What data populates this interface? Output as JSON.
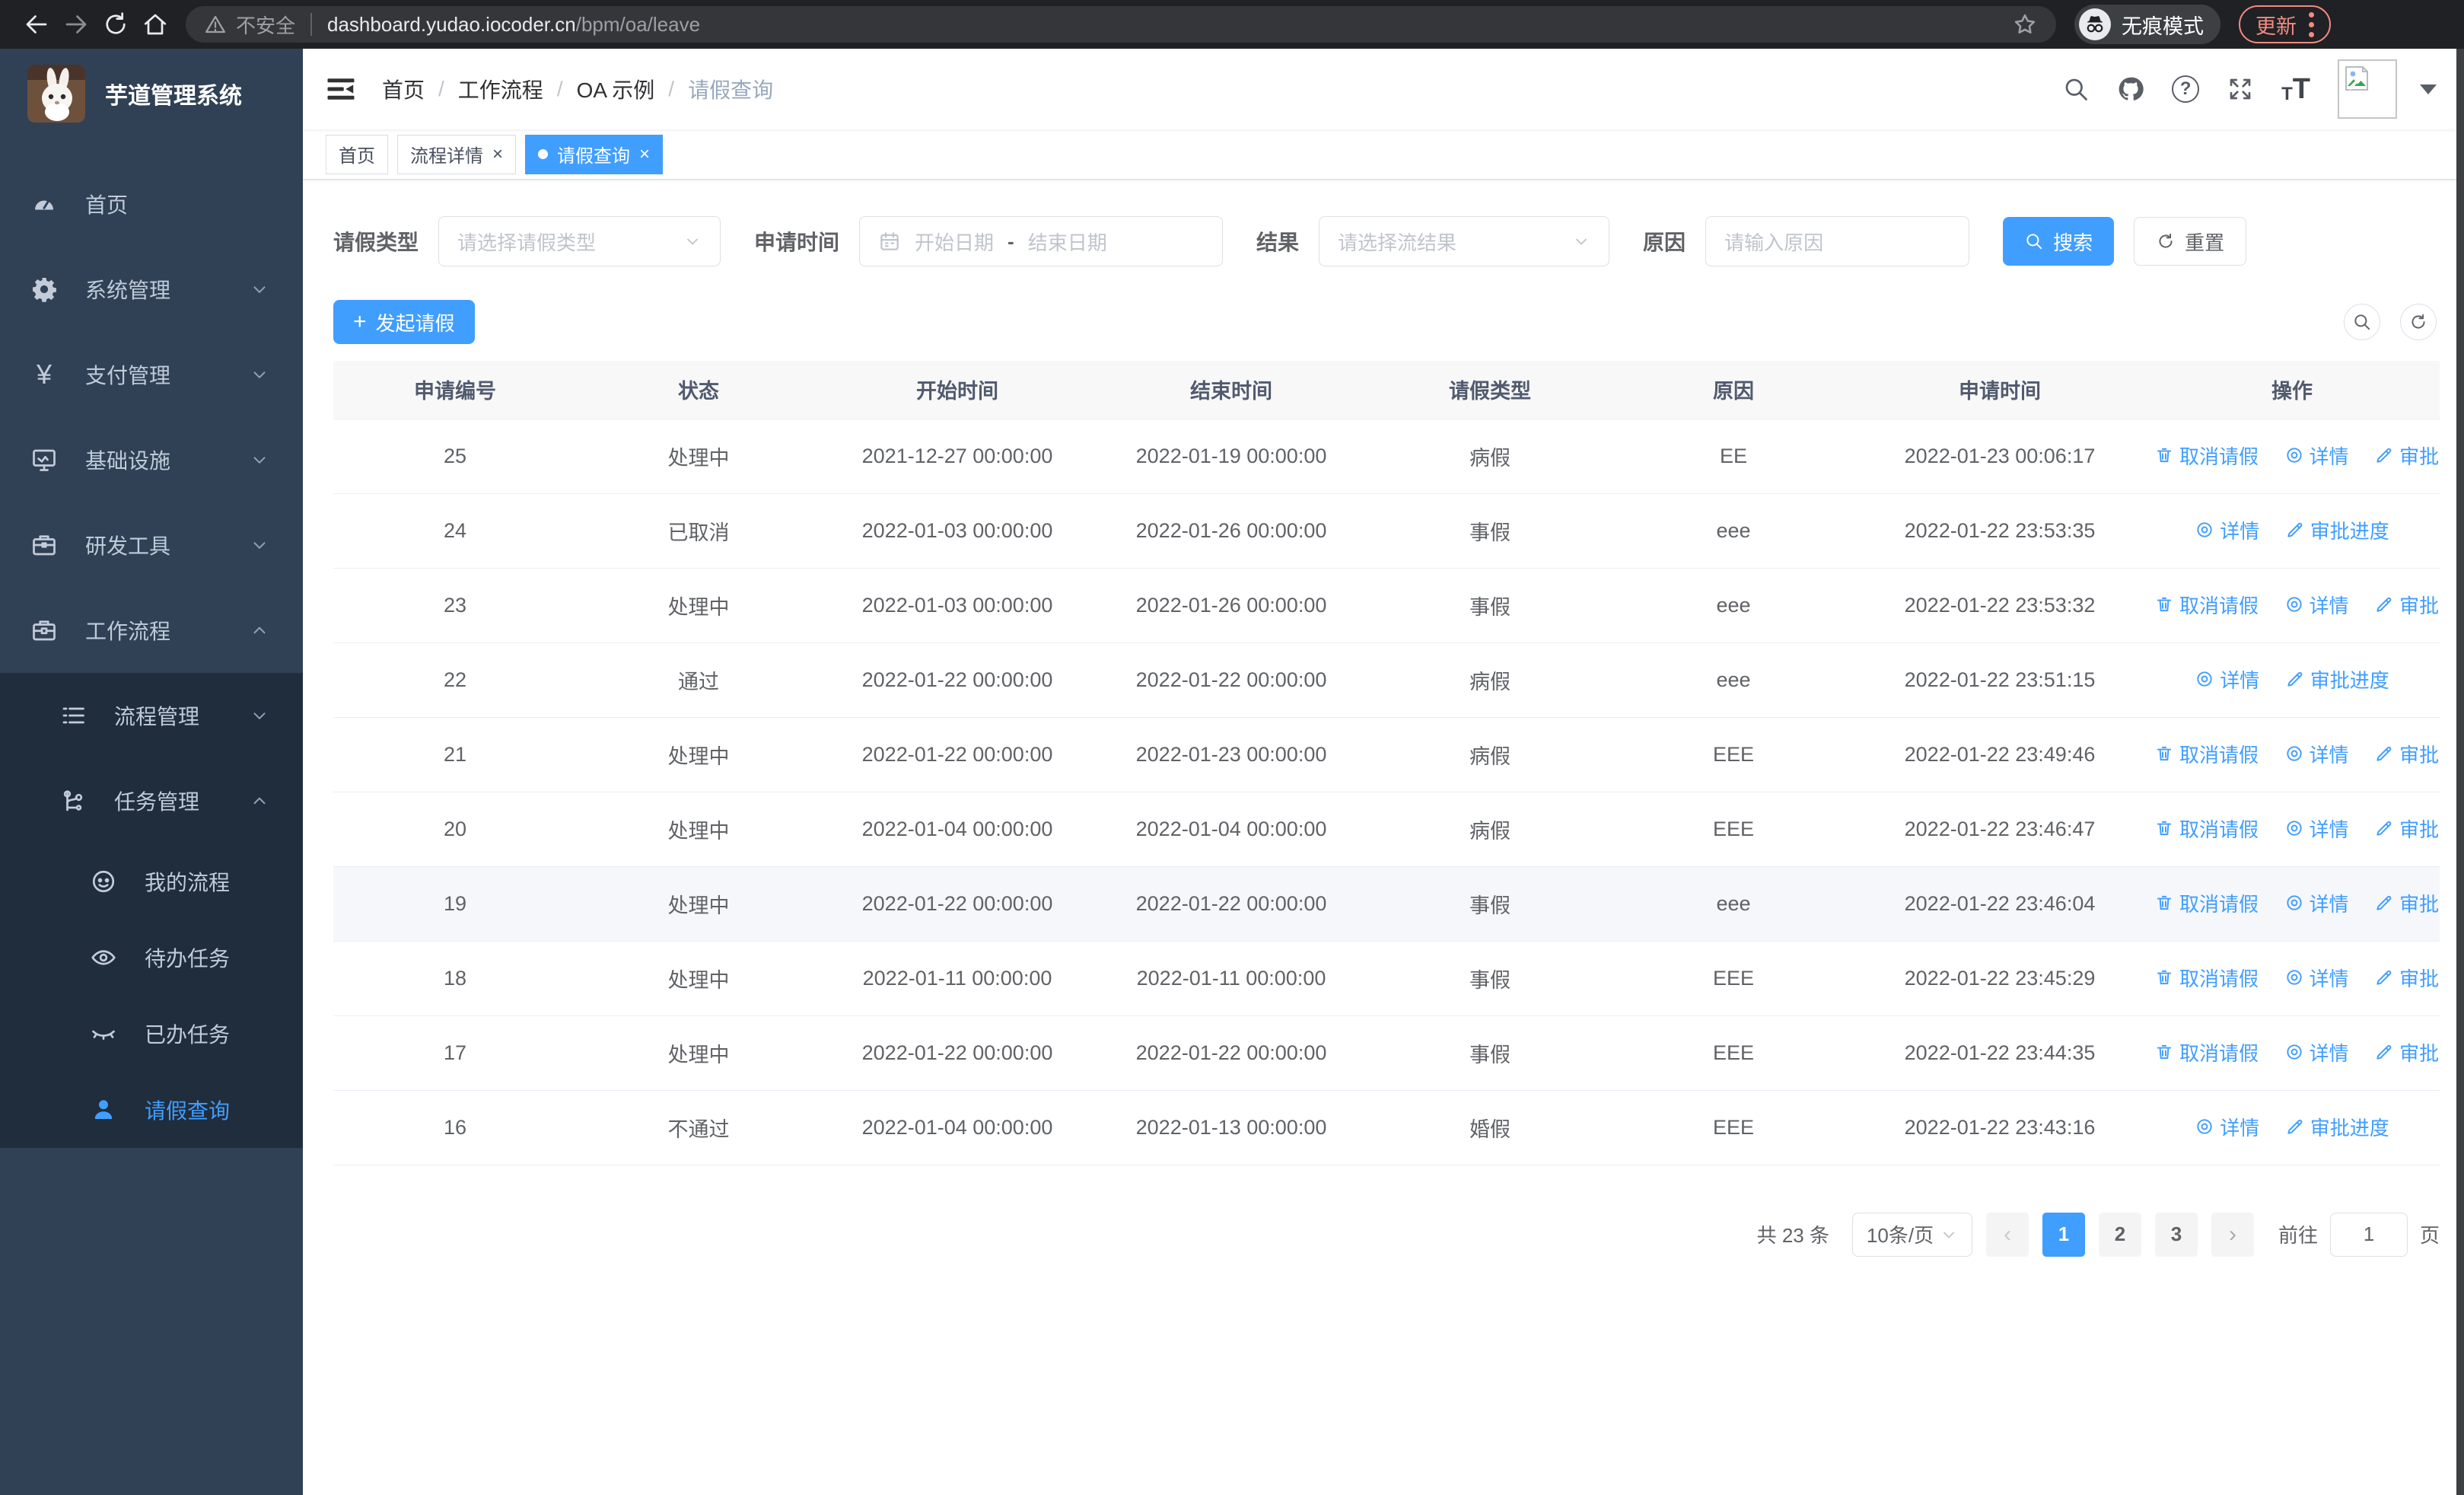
{
  "browser": {
    "security_label": "不安全",
    "url_host": "dashboard.yudao.iocoder.cn",
    "url_path": "/bpm/oa/leave",
    "incognito_label": "无痕模式",
    "update_label": "更新"
  },
  "sidebar": {
    "title": "芋道管理系统",
    "menu": [
      {
        "label": "首页"
      },
      {
        "label": "系统管理"
      },
      {
        "label": "支付管理"
      },
      {
        "label": "基础设施"
      },
      {
        "label": "研发工具"
      },
      {
        "label": "工作流程"
      }
    ],
    "submenu": [
      {
        "label": "流程管理"
      },
      {
        "label": "任务管理"
      }
    ],
    "task_menu": [
      {
        "label": "我的流程"
      },
      {
        "label": "待办任务"
      },
      {
        "label": "已办任务"
      }
    ],
    "active_item": {
      "label": "请假查询"
    }
  },
  "navbar": {
    "breadcrumb": [
      "首页",
      "工作流程",
      "OA 示例",
      "请假查询"
    ]
  },
  "tabs": [
    {
      "label": "首页"
    },
    {
      "label": "流程详情",
      "close": "×"
    },
    {
      "label": "请假查询",
      "close": "×"
    }
  ],
  "filters": {
    "leave_type_label": "请假类型",
    "leave_type_placeholder": "请选择请假类型",
    "apply_time_label": "申请时间",
    "date_start_placeholder": "开始日期",
    "date_separator": "-",
    "date_end_placeholder": "结束日期",
    "result_label": "结果",
    "result_placeholder": "请选择流结果",
    "reason_label": "原因",
    "reason_placeholder": "请输入原因",
    "search_label": "搜索",
    "reset_label": "重置"
  },
  "toolbar": {
    "create_label": "发起请假"
  },
  "table": {
    "columns": [
      "申请编号",
      "状态",
      "开始时间",
      "结束时间",
      "请假类型",
      "原因",
      "申请时间",
      "操作"
    ],
    "actions": {
      "cancel": "取消请假",
      "detail": "详情",
      "progress": "审批进度"
    },
    "rows": [
      {
        "id": "25",
        "status": "处理中",
        "start": "2021-12-27 00:00:00",
        "end": "2022-01-19 00:00:00",
        "type": "病假",
        "reason": "EE",
        "apply_time": "2022-01-23 00:06:17",
        "can_cancel": true,
        "highlight": false
      },
      {
        "id": "24",
        "status": "已取消",
        "start": "2022-01-03 00:00:00",
        "end": "2022-01-26 00:00:00",
        "type": "事假",
        "reason": "eee",
        "apply_time": "2022-01-22 23:53:35",
        "can_cancel": false,
        "highlight": false
      },
      {
        "id": "23",
        "status": "处理中",
        "start": "2022-01-03 00:00:00",
        "end": "2022-01-26 00:00:00",
        "type": "事假",
        "reason": "eee",
        "apply_time": "2022-01-22 23:53:32",
        "can_cancel": true,
        "highlight": false
      },
      {
        "id": "22",
        "status": "通过",
        "start": "2022-01-22 00:00:00",
        "end": "2022-01-22 00:00:00",
        "type": "病假",
        "reason": "eee",
        "apply_time": "2022-01-22 23:51:15",
        "can_cancel": false,
        "highlight": false
      },
      {
        "id": "21",
        "status": "处理中",
        "start": "2022-01-22 00:00:00",
        "end": "2022-01-23 00:00:00",
        "type": "病假",
        "reason": "EEE",
        "apply_time": "2022-01-22 23:49:46",
        "can_cancel": true,
        "highlight": false
      },
      {
        "id": "20",
        "status": "处理中",
        "start": "2022-01-04 00:00:00",
        "end": "2022-01-04 00:00:00",
        "type": "病假",
        "reason": "EEE",
        "apply_time": "2022-01-22 23:46:47",
        "can_cancel": true,
        "highlight": false
      },
      {
        "id": "19",
        "status": "处理中",
        "start": "2022-01-22 00:00:00",
        "end": "2022-01-22 00:00:00",
        "type": "事假",
        "reason": "eee",
        "apply_time": "2022-01-22 23:46:04",
        "can_cancel": true,
        "highlight": true
      },
      {
        "id": "18",
        "status": "处理中",
        "start": "2022-01-11 00:00:00",
        "end": "2022-01-11 00:00:00",
        "type": "事假",
        "reason": "EEE",
        "apply_time": "2022-01-22 23:45:29",
        "can_cancel": true,
        "highlight": false
      },
      {
        "id": "17",
        "status": "处理中",
        "start": "2022-01-22 00:00:00",
        "end": "2022-01-22 00:00:00",
        "type": "事假",
        "reason": "EEE",
        "apply_time": "2022-01-22 23:44:35",
        "can_cancel": true,
        "highlight": false
      },
      {
        "id": "16",
        "status": "不通过",
        "start": "2022-01-04 00:00:00",
        "end": "2022-01-13 00:00:00",
        "type": "婚假",
        "reason": "EEE",
        "apply_time": "2022-01-22 23:43:16",
        "can_cancel": false,
        "highlight": false
      }
    ]
  },
  "pagination": {
    "total": "共 23 条",
    "per_page": "10条/页",
    "pages": [
      "1",
      "2",
      "3"
    ],
    "prev": "‹",
    "next": "›",
    "goto_label": "前往",
    "goto_value": "1",
    "page_label": "页"
  },
  "colors": {
    "primary": "#409eff",
    "sidebar_bg": "#304156",
    "submenu_bg": "#1f2d3d",
    "chrome_bg": "#202124",
    "update_accent": "#f28b82",
    "table_header_bg": "#f8f8f9",
    "row_hover_bg": "#f5f7fa"
  }
}
